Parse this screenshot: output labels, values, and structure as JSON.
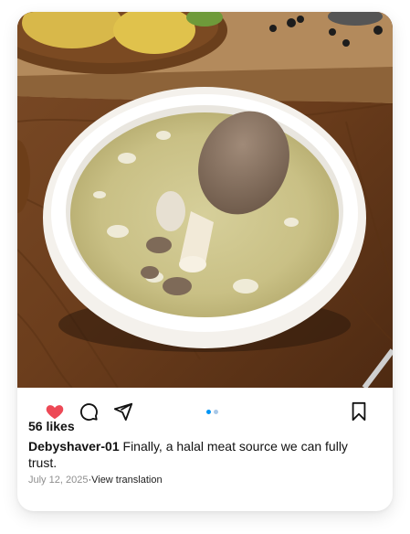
{
  "post": {
    "likes_text": "56 likes",
    "username": "Debyshaver-01",
    "caption": "Finally, a halal meat source we can fully trust.",
    "date": "July 12, 2025",
    "separator": "·",
    "translate_link": "View translation"
  },
  "icons": {
    "like": "heart-icon",
    "comment": "comment-icon",
    "share": "send-icon",
    "save": "bookmark-icon"
  },
  "carousel": {
    "total": 2,
    "active": 1
  },
  "colors": {
    "heart": "#ed4956",
    "dot_active": "#0095f6",
    "dot_inactive": "#a8c8e8"
  }
}
